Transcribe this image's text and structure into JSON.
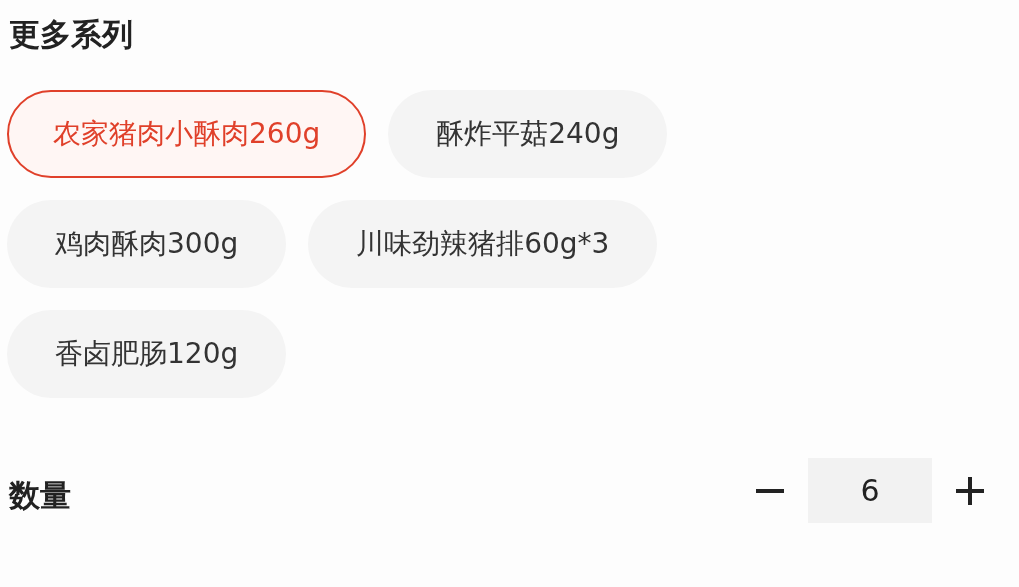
{
  "section_title": "更多系列",
  "options": [
    {
      "label": "农家猪肉小酥肉260g",
      "selected": true
    },
    {
      "label": "酥炸平菇240g",
      "selected": false
    },
    {
      "label": "鸡肉酥肉300g",
      "selected": false
    },
    {
      "label": "川味劲辣猪排60g*3",
      "selected": false
    },
    {
      "label": "香卤肥肠120g",
      "selected": false
    }
  ],
  "quantity": {
    "label": "数量",
    "value": "6"
  }
}
